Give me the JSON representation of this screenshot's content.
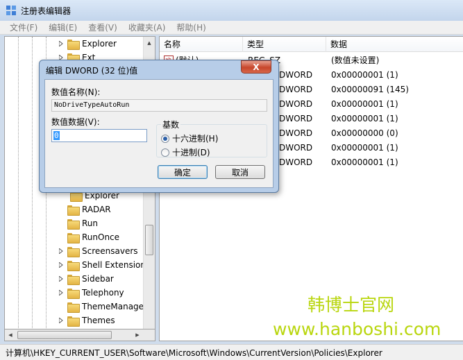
{
  "window": {
    "title": "注册表编辑器"
  },
  "menu": [
    "文件(F)",
    "编辑(E)",
    "查看(V)",
    "收藏夹(A)",
    "帮助(H)"
  ],
  "tree": {
    "items": [
      {
        "label": "Explorer",
        "expandable": true
      },
      {
        "label": "Ext",
        "expandable": true
      },
      {
        "label": "Explorer",
        "expandable": false,
        "selected": true
      },
      {
        "label": "RADAR",
        "expandable": false
      },
      {
        "label": "Run",
        "expandable": false
      },
      {
        "label": "RunOnce",
        "expandable": false
      },
      {
        "label": "Screensavers",
        "expandable": true
      },
      {
        "label": "Shell Extensions",
        "expandable": true
      },
      {
        "label": "Sidebar",
        "expandable": true
      },
      {
        "label": "Telephony",
        "expandable": true
      },
      {
        "label": "ThemeManager",
        "expandable": false
      },
      {
        "label": "Themes",
        "expandable": true
      }
    ]
  },
  "list": {
    "columns": [
      "名称",
      "类型",
      "数据"
    ],
    "rows": [
      {
        "name": "(默认)",
        "type": "REG_SZ",
        "data": "(数值未设置)"
      },
      {
        "name": "",
        "type": "DWORD",
        "data": "0x00000001 (1)"
      },
      {
        "name": "",
        "type": "DWORD",
        "data": "0x00000091 (145)"
      },
      {
        "name": "",
        "type": "DWORD",
        "data": "0x00000001 (1)"
      },
      {
        "name": "",
        "type": "DWORD",
        "data": "0x00000001 (1)"
      },
      {
        "name": "",
        "type": "DWORD",
        "data": "0x00000000 (0)"
      },
      {
        "name": "",
        "type": "DWORD",
        "data": "0x00000001 (1)"
      },
      {
        "name": "",
        "type": "DWORD",
        "data": "0x00000001 (1)"
      }
    ]
  },
  "dialog": {
    "title": "编辑 DWORD (32 位)值",
    "close": "X",
    "name_label": "数值名称(N):",
    "name_value": "NoDriveTypeAutoRun",
    "data_label": "数值数据(V):",
    "data_value": "0",
    "base_label": "基数",
    "hex_label": "十六进制(H)",
    "dec_label": "十进制(D)",
    "selected_base": "hex",
    "ok": "确定",
    "cancel": "取消"
  },
  "watermark": {
    "line1": "韩博士官网",
    "line2": "www.hanboshi.com"
  },
  "status": {
    "path": "计算机\\HKEY_CURRENT_USER\\Software\\Microsoft\\Windows\\CurrentVersion\\Policies\\Explorer"
  }
}
